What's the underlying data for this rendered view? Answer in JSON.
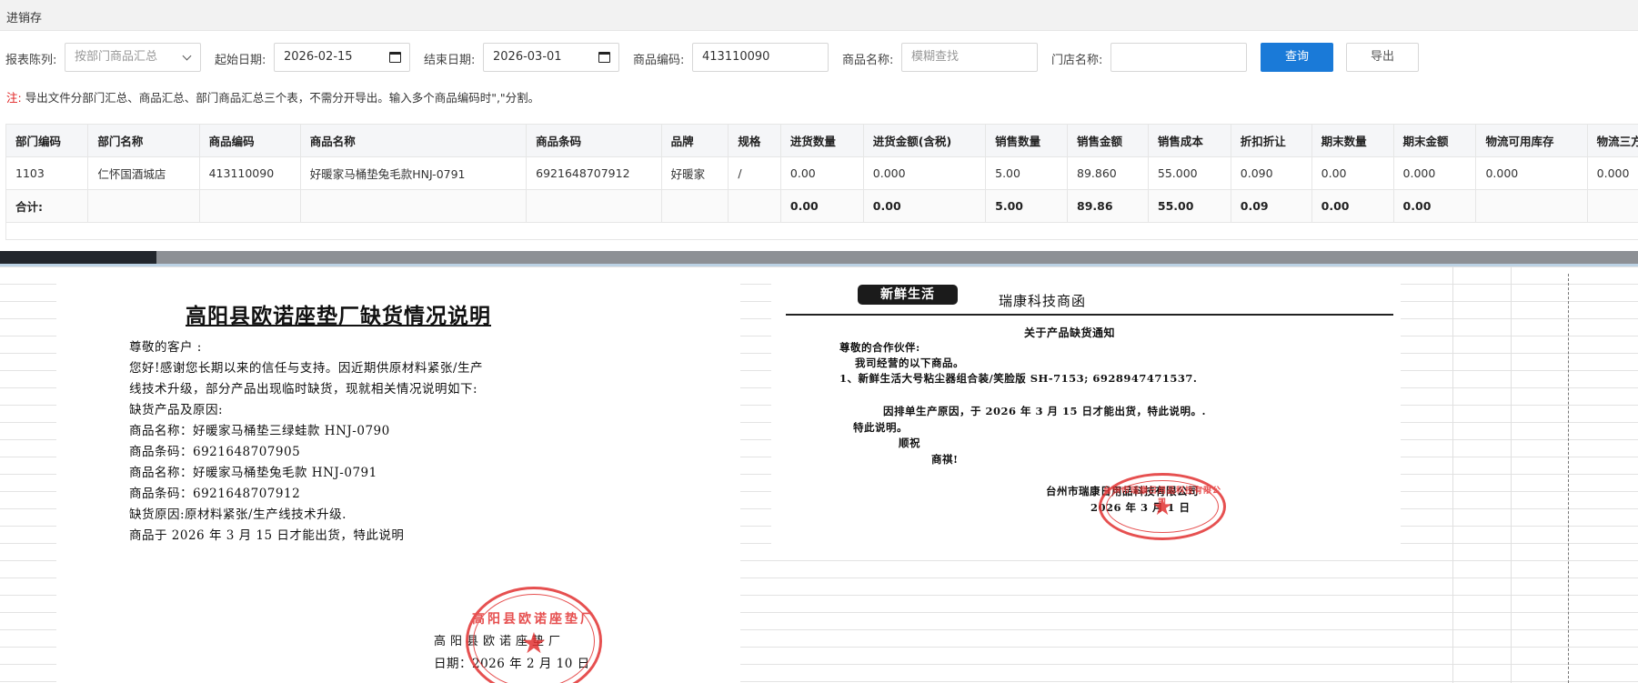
{
  "app": {
    "title": "进销存"
  },
  "filters": {
    "report_type_label": "报表陈列:",
    "report_type_value": "按部门商品汇总",
    "start_date_label": "起始日期:",
    "start_date_value": "2026-02-15",
    "end_date_label": "结束日期:",
    "end_date_value": "2026-03-01",
    "product_code_label": "商品编码:",
    "product_code_value": "413110090",
    "product_name_label": "商品名称:",
    "product_name_placeholder": "模糊查找",
    "store_name_label": "门店名称:",
    "store_name_value": "",
    "query_label": "查询",
    "export_label": "导出"
  },
  "note": {
    "prefix": "注:",
    "text": "导出文件分部门汇总、商品汇总、部门商品汇总三个表，不需分开导出。输入多个商品编码时\",\"分割。"
  },
  "table": {
    "headers": [
      "部门编码",
      "部门名称",
      "商品编码",
      "商品名称",
      "商品条码",
      "品牌",
      "规格",
      "进货数量",
      "进货金额(含税)",
      "销售数量",
      "销售金额",
      "销售成本",
      "折扣折让",
      "期末数量",
      "期末金额",
      "物流可用库存",
      "物流三方库"
    ],
    "rows": [
      [
        "1103",
        "仁怀国酒城店",
        "413110090",
        "好暖家马桶垫兔毛款HNJ-0791",
        "6921648707912",
        "好暖家",
        "/",
        "0.00",
        "0.000",
        "5.00",
        "89.860",
        "55.000",
        "0.090",
        "0.00",
        "0.000",
        "0.000",
        "0.000"
      ]
    ],
    "summary": [
      "合计:",
      "",
      "",
      "",
      "",
      "",
      "",
      "0.00",
      "0.00",
      "5.00",
      "89.86",
      "55.00",
      "0.09",
      "0.00",
      "0.00",
      "",
      ""
    ]
  },
  "doc1": {
    "title": "高阳县欧诺座垫厂缺货情况说明",
    "lines": [
      "尊敬的客户  :",
      "您好!感谢您长期以来的信任与支持。因近期供原材料紧张/生产",
      "线技术升级，部分产品出现临时缺货，现就相关情况说明如下:",
      "缺货产品及原因:",
      "商品名称：好暖家马桶垫三绿蛙款 HNJ-0790",
      "商品条码：6921648707905",
      "商品名称：好暖家马桶垫兔毛款 HNJ-0791",
      "商品条码：6921648707912",
      "缺货原因:原材料紧张/生产线技术升级.",
      "商品于 2026 年 3 月 15 日才能出货，特此说明"
    ],
    "signature": "高阳县欧诺座垫厂",
    "date": "日期：2026 年 2 月 10 日",
    "stamp_text": "高阳县欧诺座垫厂"
  },
  "doc2": {
    "logo": "新鲜生活",
    "company": "瑞康科技商函",
    "heading": "关于产品缺货通知",
    "greeting": "尊敬的合作伙伴:",
    "line1": "我司经营的以下商品。",
    "line2": "1、新鲜生活大号粘尘器组合装/笑脸版 SH-7153; 6928947471537.",
    "line3": "因排单生产原因，于 2026 年 3 月 15 日才能出货，特此说明。.",
    "line4": "特此说明。",
    "line5": "顺祝",
    "line6": "商祺!",
    "signature": "台州市瑞康日用品科技有限公司",
    "date": "2026 年 3 月 1 日",
    "stamp_text": "台州市瑞康日用品科技有限公司"
  },
  "colors": {
    "primary": "#1a7ad8",
    "note_red": "#e02020",
    "stamp_red": "#e23232"
  }
}
